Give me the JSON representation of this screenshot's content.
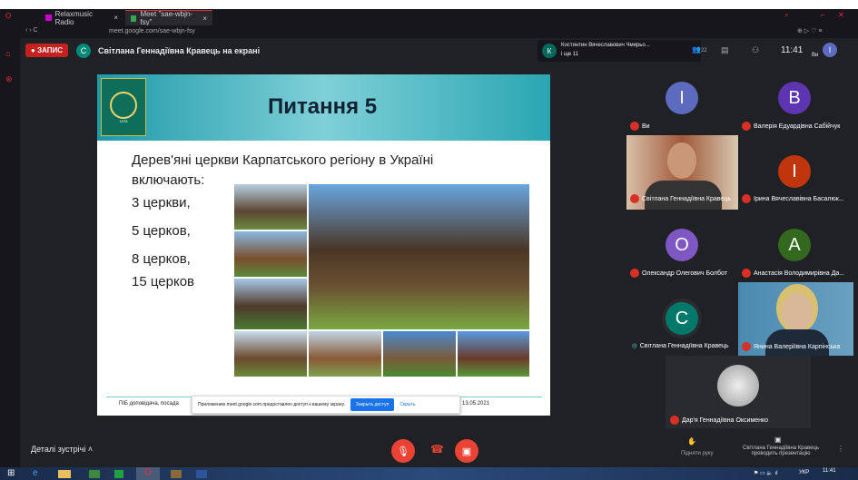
{
  "browser": {
    "tabs": [
      {
        "label": "Relaxmusic Radio"
      },
      {
        "label": "Meet \"sae-wbjn-fsy\""
      }
    ],
    "url": "meet.google.com/sae-wbjn-fsy"
  },
  "header": {
    "record_label": "ЗАПИС",
    "presenter_initial": "С",
    "presenter_text": "Світлана Геннадіївна Кравець на екрані",
    "notification_initial": "К",
    "notification_name": "Костянтин Вячеславович Чмирьо...",
    "notification_sub": "і ще 11",
    "participants_count": "22",
    "time": "11:41",
    "self_label": "Ви",
    "self_initial": "I"
  },
  "slide": {
    "title": "Питання 5",
    "question": "Дерев'яні церкви Карпатського регіону в Україні включають:",
    "options": [
      "3 церкви,",
      "5 церков,",
      "8 церков,",
      "15 церков"
    ],
    "footer_left": "ПІБ доповідача, посада",
    "footer_date": "13.05.2021",
    "logo_year": "1978"
  },
  "share_bar": {
    "text": "Приложению meet.google.com предоставлен доступ к вашему экрану.",
    "stop": "Закрыть доступ",
    "hide": "Скрыть"
  },
  "participants": [
    {
      "initial": "I",
      "name": "Ви",
      "color": "#5c6bc0"
    },
    {
      "initial": "B",
      "name": "Валерія Едуардівна Сабійчук",
      "color": "#5e35b1"
    },
    {
      "initial": "",
      "name": "Світлана Геннадіївна Кравець",
      "color": ""
    },
    {
      "initial": "I",
      "name": "Ірина Вячеславівна Басалюк...",
      "color": "#bf360c"
    },
    {
      "initial": "O",
      "name": "Олександр Олегович Болбот",
      "color": "#7e57c2"
    },
    {
      "initial": "A",
      "name": "Анастасія Володимирівна Да...",
      "color": "#33691e"
    },
    {
      "initial": "C",
      "name": "Світлана Геннадіївна Кравець",
      "color": "#00796b"
    },
    {
      "initial": "",
      "name": "Янина Валеріївна Карпінська",
      "color": ""
    },
    {
      "initial": "",
      "name": "Дар'я Геннадіївна Оксименко",
      "color": ""
    }
  ],
  "bottom": {
    "details": "Деталі зустрічі",
    "raise_hand": "Підняти руку",
    "presenting": "Світлана Геннадіївна Кравець проводить презентацію"
  },
  "taskbar": {
    "time": "11:41",
    "lang": "УКР"
  }
}
